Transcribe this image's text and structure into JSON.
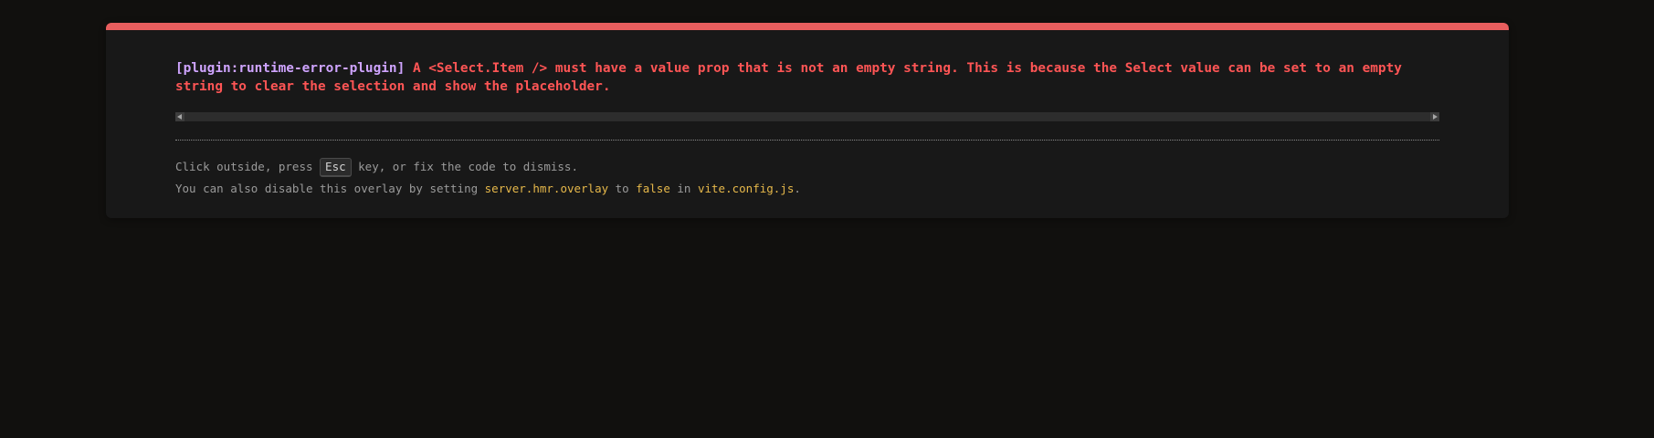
{
  "error": {
    "plugin": "[plugin:runtime-error-plugin]",
    "message": "A <Select.Item /> must have a value prop that is not an empty string. This is because the Select value can be set to an empty string to clear the selection and show the placeholder."
  },
  "tip": {
    "line1_before": "Click outside, press ",
    "key": "Esc",
    "line1_after": " key, or fix the code to dismiss.",
    "line2_before": "You can also disable this overlay by setting ",
    "setting": "server.hmr.overlay",
    "to": " to ",
    "value": "false",
    "in": " in ",
    "file": "vite.config.js",
    "end": "."
  },
  "colors": {
    "accent": "#e85e5e",
    "plugin": "#cfa4ff",
    "message": "#ff5555",
    "code": "#e6b84a"
  }
}
